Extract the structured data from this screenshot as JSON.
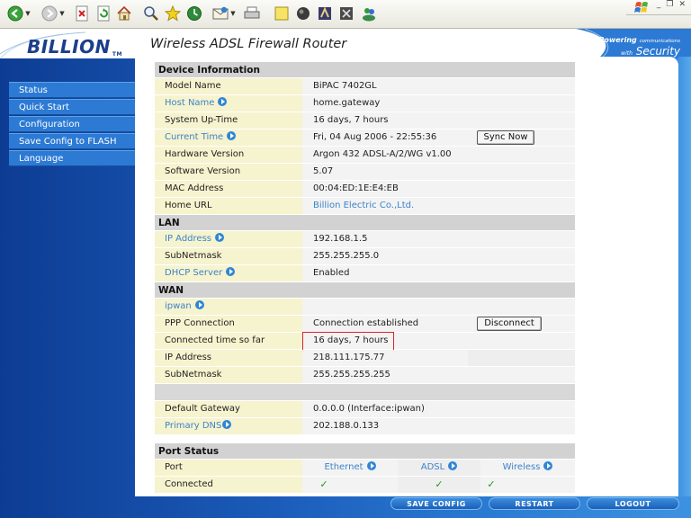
{
  "toolbar": {
    "buttons": [
      "back",
      "forward",
      "stop",
      "refresh",
      "home",
      "search",
      "favorites",
      "media",
      "mail",
      "print",
      "edit",
      "discuss",
      "messenger",
      "research",
      "msn"
    ]
  },
  "header": {
    "logo": "BILLION",
    "logo_tm": "TM",
    "title": "Wireless ADSL Firewall Router",
    "tagline_top": "Powering",
    "tagline_top_small": "communications",
    "tagline_with": "with",
    "tagline_main": "Security"
  },
  "menu": {
    "items": [
      "Status",
      "Quick Start",
      "Configuration",
      "Save Config to FLASH",
      "Language"
    ]
  },
  "device": {
    "heading": "Device Information",
    "model_label": "Model Name",
    "model_value": "BiPAC 7402GL",
    "host_label": "Host Name",
    "host_value": "home.gateway",
    "uptime_label": "System Up-Time",
    "uptime_value": "16 days, 7 hours",
    "time_label": "Current Time",
    "time_value": "Fri, 04 Aug 2006 - 22:55:36",
    "sync_button": "Sync Now",
    "hw_label": "Hardware Version",
    "hw_value": "Argon 432 ADSL-A/2/WG v1.00",
    "sw_label": "Software Version",
    "sw_value": "5.07",
    "mac_label": "MAC Address",
    "mac_value": "00:04:ED:1E:E4:EB",
    "url_label": "Home URL",
    "url_value": "Billion Electric Co.,Ltd."
  },
  "lan": {
    "heading": "LAN",
    "ip_label": "IP Address",
    "ip_value": "192.168.1.5",
    "mask_label": "SubNetmask",
    "mask_value": "255.255.255.0",
    "dhcp_label": "DHCP Server",
    "dhcp_value": "Enabled"
  },
  "wan": {
    "heading": "WAN",
    "ipwan_label": "ipwan",
    "ppp_label": "PPP Connection",
    "ppp_value": "Connection established",
    "disconnect_button": "Disconnect",
    "conn_time_label": "Connected time so far",
    "conn_time_value": "16 days, 7 hours",
    "ip_label": "IP Address",
    "ip_value": "218.111.175.77",
    "mask_label": "SubNetmask",
    "mask_value": "255.255.255.255",
    "gw_label": "Default Gateway",
    "gw_value": "0.0.0.0  (Interface:ipwan)",
    "dns_label": "Primary DNS",
    "dns_value": "202.188.0.133"
  },
  "port_status": {
    "heading": "Port Status",
    "port_label": "Port",
    "columns": [
      "Ethernet",
      "ADSL",
      "Wireless"
    ],
    "connected_label": "Connected",
    "check": "✓"
  },
  "bottom": {
    "save": "SAVE CONFIG",
    "restart": "RESTART",
    "logout": "LOGOUT"
  },
  "colors": {
    "brand_blue": "#1c3f8c",
    "label_bg": "#f6f3cf",
    "link": "#3d83c9",
    "highlight": "#d9252b"
  }
}
